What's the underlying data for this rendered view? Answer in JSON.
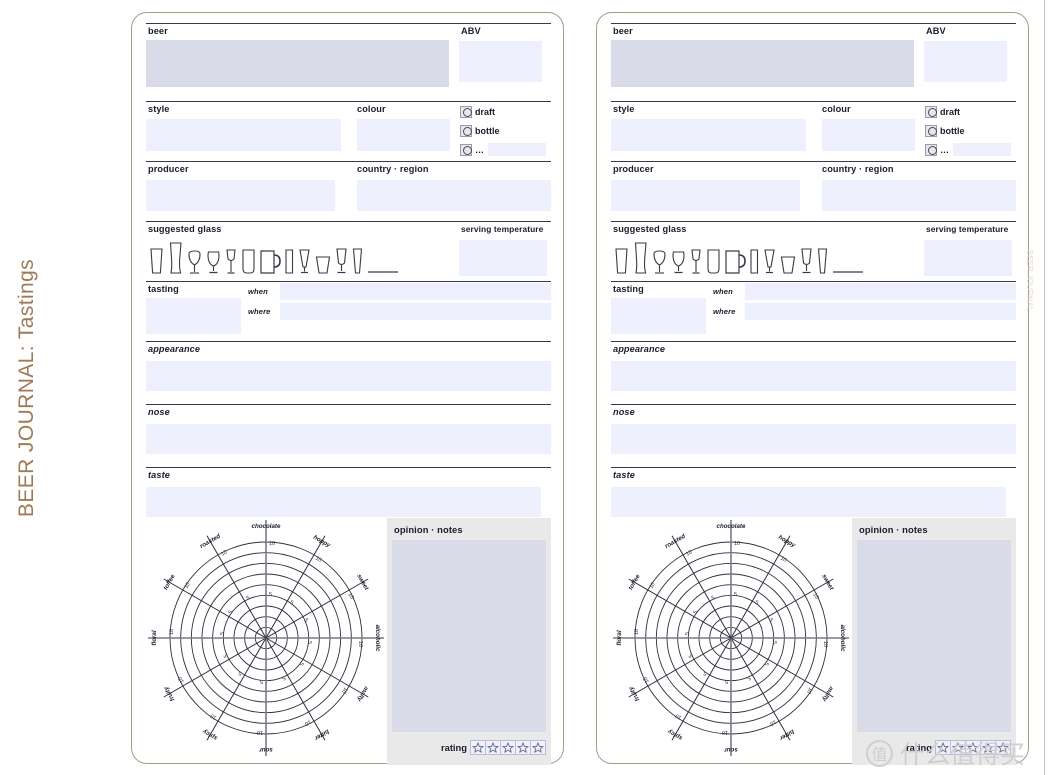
{
  "spine": {
    "title": "BEER JOURNAL: Tastings",
    "color": "#9e7b56"
  },
  "watermark": {
    "logo": "值",
    "text": "什么值得买"
  },
  "edge_text": "BEER JOURNAL",
  "page": {
    "fields": {
      "beer": {
        "label": "beer",
        "value": "",
        "placeholder": ""
      },
      "abv": {
        "label": "ABV",
        "value": "",
        "placeholder": ""
      },
      "style": {
        "label": "style",
        "value": "",
        "placeholder": ""
      },
      "colour": {
        "label": "colour",
        "value": "",
        "placeholder": ""
      },
      "producer": {
        "label": "producer",
        "value": "",
        "placeholder": ""
      },
      "country_region": {
        "label": "country · region",
        "value": "",
        "placeholder": ""
      },
      "suggested_glass": {
        "label": "suggested glass"
      },
      "serving_temperature": {
        "label": "serving temperature",
        "value": "",
        "placeholder": ""
      },
      "tasting": {
        "label": "tasting",
        "value": "",
        "placeholder": ""
      },
      "when": {
        "label": "when",
        "value": "",
        "placeholder": ""
      },
      "where": {
        "label": "where",
        "value": "",
        "placeholder": ""
      },
      "appearance": {
        "label": "appearance",
        "value": "",
        "placeholder": ""
      },
      "nose": {
        "label": "nose",
        "value": "",
        "placeholder": ""
      },
      "taste": {
        "label": "taste",
        "value": "",
        "placeholder": ""
      },
      "opinion_notes": {
        "label": "opinion · notes",
        "value": "",
        "placeholder": ""
      },
      "rating": {
        "label": "rating",
        "value": 0,
        "max": 5
      }
    },
    "serving_options": [
      {
        "id": "draft",
        "label": "draft",
        "selected": false
      },
      {
        "id": "bottle",
        "label": "bottle",
        "selected": false
      },
      {
        "id": "other",
        "label": "…",
        "selected": false,
        "has_input": true,
        "value": ""
      }
    ],
    "glass_icons": [
      "pint-glass-icon",
      "weizen-glass-icon",
      "tulip-glass-icon",
      "snifter-glass-icon",
      "goblet-glass-icon",
      "nonic-pint-glass-icon",
      "beer-mug-icon",
      "stange-glass-icon",
      "pilsner-glass-icon",
      "tumbler-glass-icon",
      "chalice-glass-icon",
      "flute-glass-icon",
      "blank-line-icon"
    ]
  },
  "chart_data": {
    "type": "radar",
    "title": "",
    "axes": [
      "chocolate",
      "hoppy",
      "sweet",
      "alcoholic",
      "malty",
      "bitter",
      "sour",
      "spicy",
      "fruity",
      "floral",
      "toffee",
      "roasted"
    ],
    "values": [
      0,
      0,
      0,
      0,
      0,
      0,
      0,
      0,
      0,
      0,
      0,
      0
    ],
    "tick_labels": [
      "5",
      "10"
    ],
    "radial_range": [
      0,
      10
    ],
    "rings": 9,
    "grid": true,
    "legend": "none"
  },
  "colors": {
    "field_dark": "#d9dce8",
    "field_light": "#eef0fd",
    "rule": "#3a3a44",
    "page_border": "#a79b86",
    "spine_text": "#9e7b56",
    "opinion_panel": "#e9e9e9"
  }
}
